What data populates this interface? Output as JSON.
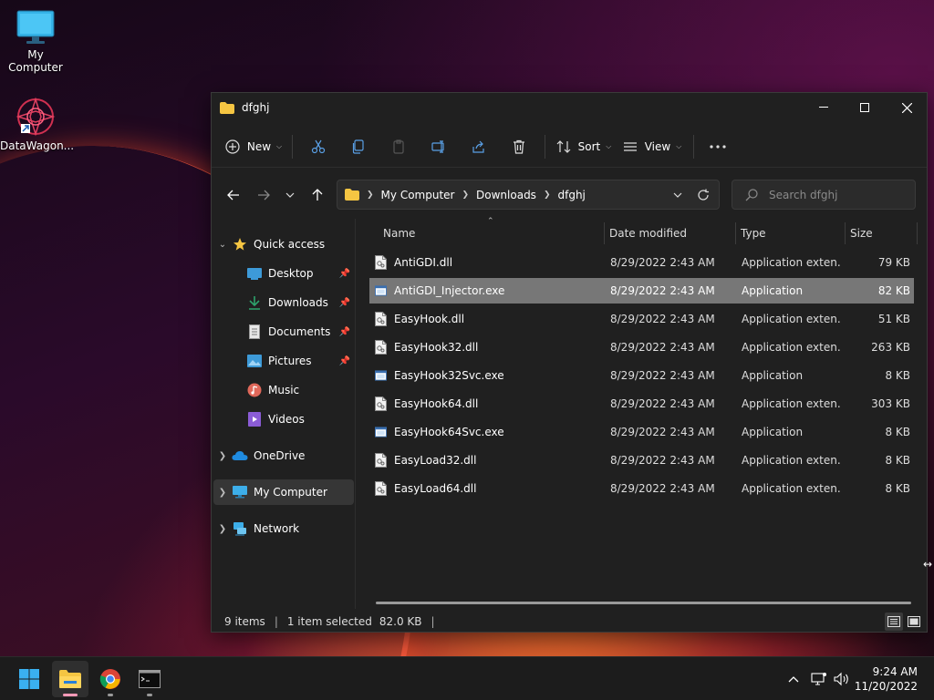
{
  "desktop": {
    "icons": [
      {
        "label": "My Computer"
      },
      {
        "label": "DataWagon..."
      }
    ]
  },
  "window": {
    "title": "dfghj",
    "toolbar": {
      "new_label": "New",
      "sort_label": "Sort",
      "view_label": "View"
    },
    "address": {
      "crumbs": [
        "My Computer",
        "Downloads",
        "dfghj"
      ],
      "search_placeholder": "Search dfghj"
    },
    "nav": {
      "quick_access": "Quick access",
      "items": [
        {
          "label": "Desktop",
          "icon": "desktop-icon",
          "pinned": true
        },
        {
          "label": "Downloads",
          "icon": "downloads-icon",
          "pinned": true
        },
        {
          "label": "Documents",
          "icon": "documents-icon",
          "pinned": true
        },
        {
          "label": "Pictures",
          "icon": "pictures-icon",
          "pinned": true
        },
        {
          "label": "Music",
          "icon": "music-icon",
          "pinned": false
        },
        {
          "label": "Videos",
          "icon": "videos-icon",
          "pinned": false
        }
      ],
      "onedrive": "OneDrive",
      "my_computer": "My Computer",
      "network": "Network"
    },
    "columns": {
      "name": "Name",
      "date": "Date modified",
      "type": "Type",
      "size": "Size"
    },
    "files": [
      {
        "name": "AntiGDI.dll",
        "date": "8/29/2022 2:43 AM",
        "type": "Application exten...",
        "size": "79 KB",
        "kind": "dll",
        "selected": false
      },
      {
        "name": "AntiGDI_Injector.exe",
        "date": "8/29/2022 2:43 AM",
        "type": "Application",
        "size": "82 KB",
        "kind": "exe",
        "selected": true
      },
      {
        "name": "EasyHook.dll",
        "date": "8/29/2022 2:43 AM",
        "type": "Application exten...",
        "size": "51 KB",
        "kind": "dll",
        "selected": false
      },
      {
        "name": "EasyHook32.dll",
        "date": "8/29/2022 2:43 AM",
        "type": "Application exten...",
        "size": "263 KB",
        "kind": "dll",
        "selected": false
      },
      {
        "name": "EasyHook32Svc.exe",
        "date": "8/29/2022 2:43 AM",
        "type": "Application",
        "size": "8 KB",
        "kind": "exe",
        "selected": false
      },
      {
        "name": "EasyHook64.dll",
        "date": "8/29/2022 2:43 AM",
        "type": "Application exten...",
        "size": "303 KB",
        "kind": "dll",
        "selected": false
      },
      {
        "name": "EasyHook64Svc.exe",
        "date": "8/29/2022 2:43 AM",
        "type": "Application",
        "size": "8 KB",
        "kind": "exe",
        "selected": false
      },
      {
        "name": "EasyLoad32.dll",
        "date": "8/29/2022 2:43 AM",
        "type": "Application exten...",
        "size": "8 KB",
        "kind": "dll",
        "selected": false
      },
      {
        "name": "EasyLoad64.dll",
        "date": "8/29/2022 2:43 AM",
        "type": "Application exten...",
        "size": "8 KB",
        "kind": "dll",
        "selected": false
      }
    ],
    "status": {
      "items": "9 items",
      "selected": "1 item selected",
      "selected_size": "82.0 KB"
    }
  },
  "taskbar": {
    "time": "9:24 AM",
    "date": "11/20/2022"
  },
  "colors": {
    "window_bg": "#202020",
    "selected_row": "#777777",
    "accent_folder": "#f5c542"
  }
}
